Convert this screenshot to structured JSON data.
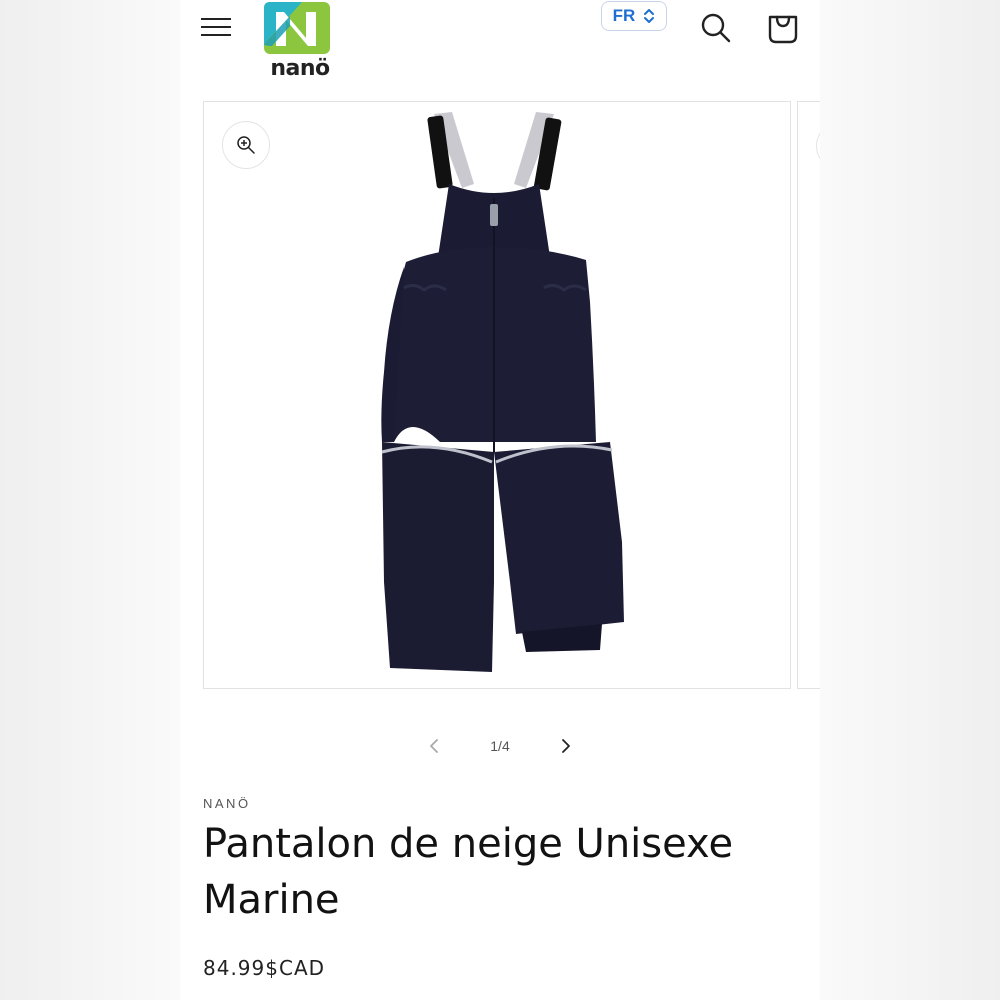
{
  "header": {
    "logo_text": "nanö",
    "language": "FR",
    "icons": {
      "menu": "hamburger-menu-icon",
      "search": "search-icon",
      "cart": "cart-icon",
      "language_toggle": "chevron-up-down-icon"
    }
  },
  "gallery": {
    "counter": "1/4",
    "image_alt": "Pantalon de neige Unisexe Marine",
    "icons": {
      "zoom": "zoom-in-icon",
      "prev": "chevron-left-icon",
      "next": "chevron-right-icon"
    }
  },
  "product": {
    "vendor": "NANÖ",
    "title": "Pantalon de neige Unisexe Marine",
    "price": "84.99$CAD"
  },
  "colors": {
    "accent": "#1f6fd1",
    "logo_teal": "#2bb3c8",
    "logo_green": "#8cc63f",
    "product_navy": "#1b1c33"
  }
}
